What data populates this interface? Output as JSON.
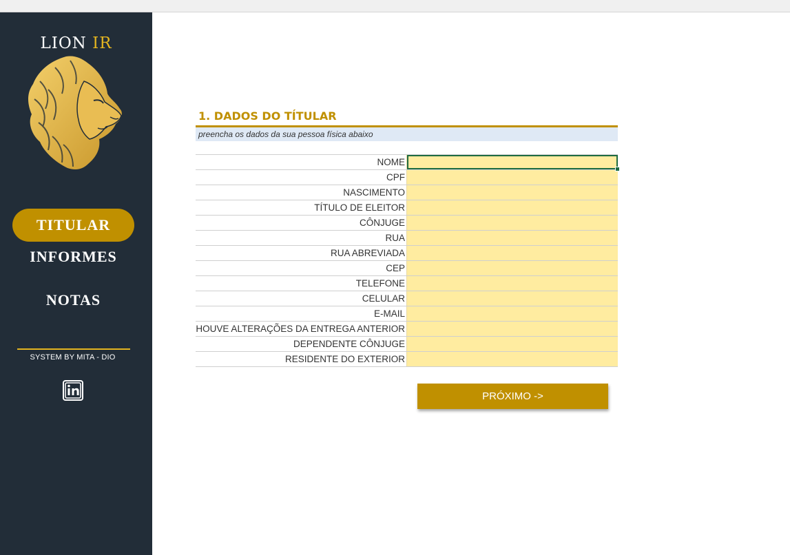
{
  "brand": {
    "name": "LION",
    "accent": "IR"
  },
  "sidebar": {
    "items": [
      {
        "label": "TITULAR",
        "active": true
      },
      {
        "label": "INFORMES",
        "active": false
      },
      {
        "label": "NOTAS",
        "active": false
      }
    ],
    "credit": "SYSTEM BY MITA - DIO",
    "social_icon": "linkedin-icon"
  },
  "main": {
    "section_title": "1. DADOS DO TÍTULAR",
    "subtitle": "preencha os dados da sua pessoa física abaixo",
    "fields": [
      {
        "label": "NOME",
        "value": ""
      },
      {
        "label": "CPF",
        "value": ""
      },
      {
        "label": "NASCIMENTO",
        "value": ""
      },
      {
        "label": "TÍTULO DE ELEITOR",
        "value": ""
      },
      {
        "label": "CÔNJUGE",
        "value": ""
      },
      {
        "label": "RUA",
        "value": ""
      },
      {
        "label": "RUA ABREVIADA",
        "value": ""
      },
      {
        "label": "CEP",
        "value": ""
      },
      {
        "label": "TELEFONE",
        "value": ""
      },
      {
        "label": "CELULAR",
        "value": ""
      },
      {
        "label": "E-MAIL",
        "value": ""
      },
      {
        "label": "HOUVE ALTERAÇÕES DA ENTREGA ANTERIOR",
        "value": ""
      },
      {
        "label": "DEPENDENTE CÔNJUGE",
        "value": ""
      },
      {
        "label": "RESIDENTE DO EXTERIOR",
        "value": ""
      }
    ],
    "next_label": "PRÓXIMO ->"
  },
  "colors": {
    "sidebar_bg": "#222d38",
    "accent_gold": "#c09000",
    "brand_gold": "#e4b520",
    "input_fill": "#ffeca0",
    "subtitle_fill": "#dfe9f5",
    "selection": "#1e6b41"
  }
}
